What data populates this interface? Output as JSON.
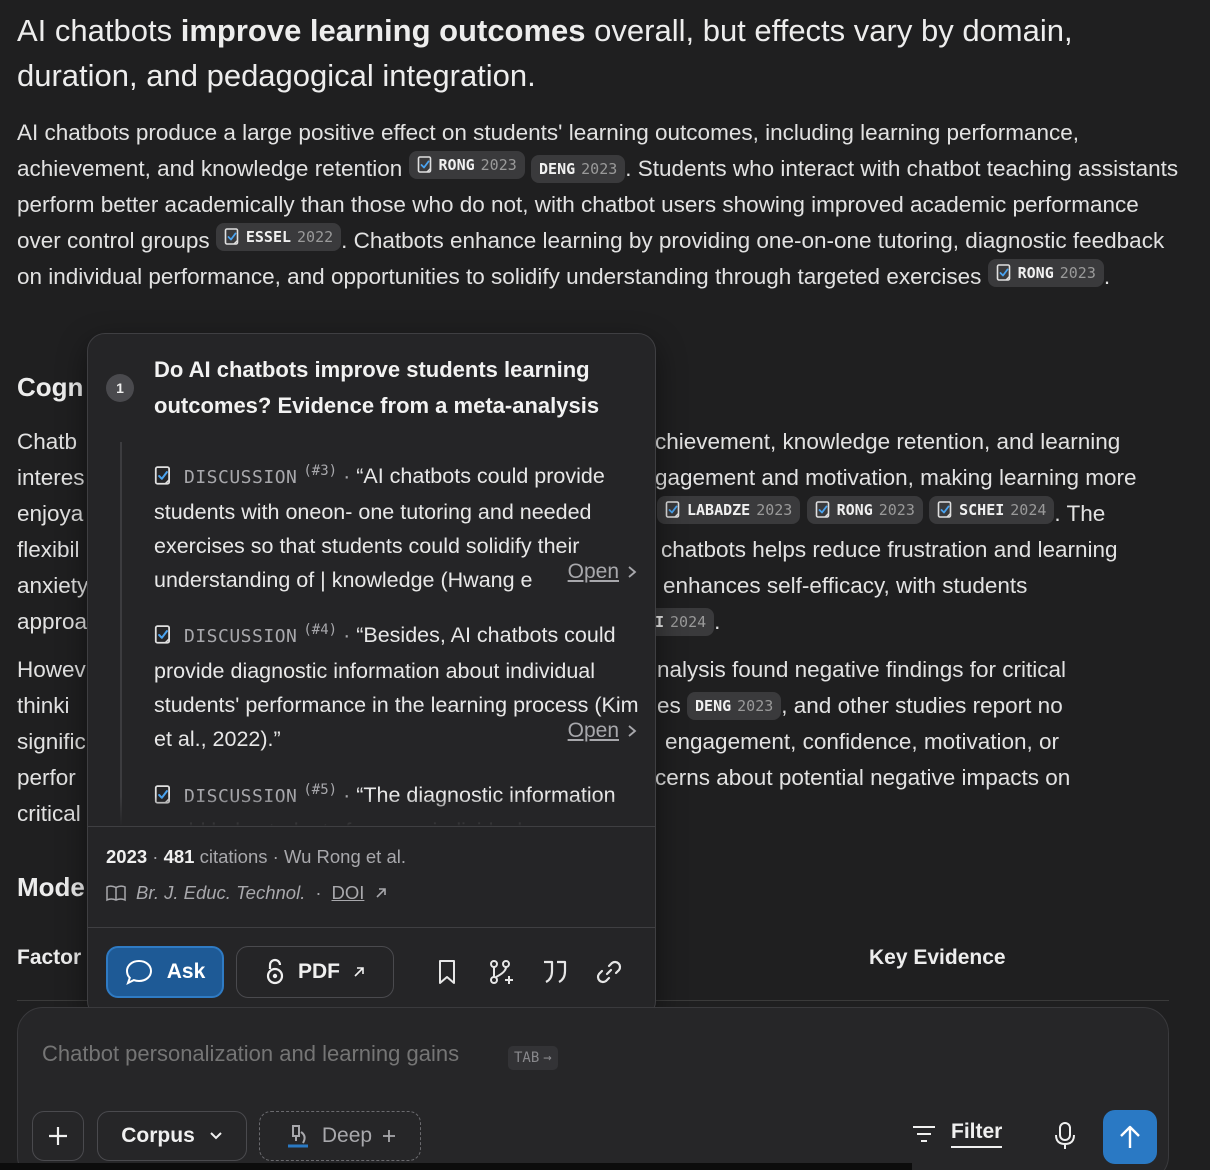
{
  "heading": {
    "pre": "AI chatbots ",
    "bold": "improve learning outcomes",
    "post": " overall, but effects vary by domain, duration, and pedagogical integration."
  },
  "para1": {
    "t1": "AI chatbots produce a large positive effect on students' learning outcomes, including learning performance, achievement, and knowledge retention ",
    "t2": ". Students who interact with chatbot teaching assistants perform better academically than those who do not, with chatbot users showing improved academic performance over control groups ",
    "t3": ". Chatbots enhance learning by providing one-on-one tutoring, diagnostic feedback on individual performance, and opportunities to solidify understanding through targeted exercises ",
    "t4": "."
  },
  "citations": {
    "rong": {
      "author": "RONG",
      "year": "2023"
    },
    "deng": {
      "author": "DENG",
      "year": "2023"
    },
    "essel": {
      "author": "ESSEL",
      "year": "2022"
    },
    "labadze": {
      "author": "LABADZE",
      "year": "2023"
    },
    "schei": {
      "author": "SCHEI",
      "year": "2024"
    },
    "partial_year": "2024"
  },
  "sections": {
    "cognitive_partial": "Cogn",
    "models_partial": "Mode"
  },
  "para2_visible": {
    "left": [
      "Chatb",
      "interes",
      "enjoya",
      "flexibil",
      "anxiety",
      "approa"
    ],
    "right": [
      "chievement, knowledge retention, and learning",
      "gagement and motivation, making learning more",
      "",
      "chatbots helps reduce frustration and learning",
      "enhances self-efficacy, with students",
      ""
    ],
    "r3_tail": ". The",
    "r6_partial_author": "I",
    "r6_tail": "."
  },
  "para3_visible": {
    "left": [
      "Howev",
      "thinki",
      "signific",
      "perfor",
      "critical"
    ],
    "right": [
      "nalysis found negative findings for critical",
      "es",
      "engagement, confidence, motivation, or",
      "cerns about potential negative impacts on",
      ""
    ],
    "r2_tail": ", and other studies report no"
  },
  "table": {
    "col1": "Factor",
    "col2": "Key Evidence"
  },
  "popover": {
    "number": "1",
    "title": "Do AI chatbots improve students learning outcomes? Evidence from a meta-analysis",
    "excerpts": [
      {
        "tag": "DISCUSSION",
        "ref": "(#3)",
        "text": "“AI chatbots could provide students with oneon- one tutoring and needed exercises so that students could solidify their understanding of | knowledge (Hwang e",
        "open": "Open"
      },
      {
        "tag": "DISCUSSION",
        "ref": "(#4)",
        "text": "“Besides, AI chatbots could provide diagnostic information about individual students' performance in the learning process (Kim et al., 2022).”",
        "open": "Open"
      },
      {
        "tag": "DISCUSSION",
        "ref": "(#5)",
        "text": "“The diagnostic information could help students focus on individual",
        "open": ""
      }
    ],
    "year": "2023",
    "citations_count": "481",
    "citations_label": "citations",
    "authors": "Wu Rong et al.",
    "journal": "Br. J. Educ. Technol.",
    "doi": "DOI",
    "ask_label": "Ask",
    "pdf_label": "PDF"
  },
  "composer": {
    "placeholder": "Chatbot personalization and learning gains",
    "tab_hint": "TAB",
    "corpus_label": "Corpus",
    "deep_label": "Deep",
    "filter_label": "Filter"
  },
  "colors": {
    "background": "#1f1f20",
    "accent": "#2a79c4",
    "ask_button": "#1e5a96",
    "citation_bg": "#3a3a3c"
  }
}
